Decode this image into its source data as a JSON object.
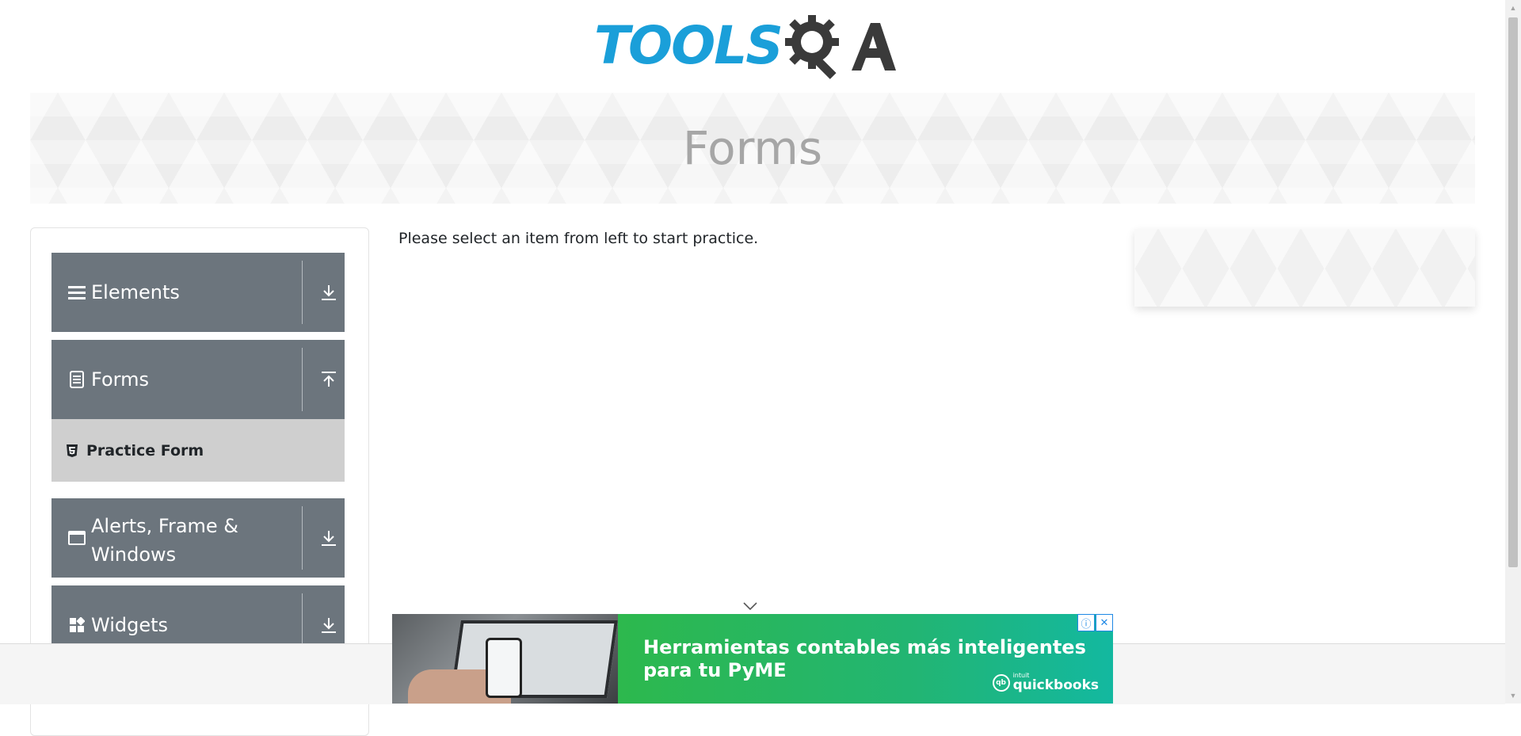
{
  "header": {
    "logo_text_tools": "TOOLS",
    "logo_text_qa": "QA"
  },
  "banner": {
    "title": "Forms"
  },
  "sidebar": {
    "groups": [
      {
        "label": "Elements",
        "icon": "menu-icon",
        "state": "collapsed"
      },
      {
        "label": "Forms",
        "icon": "document-icon",
        "state": "expanded"
      },
      {
        "label": "Alerts, Frame & Windows",
        "icon": "window-icon",
        "state": "collapsed"
      },
      {
        "label": "Widgets",
        "icon": "widgets-icon",
        "state": "collapsed"
      }
    ],
    "forms_items": [
      {
        "label": "Practice Form",
        "icon": "html5-icon"
      }
    ]
  },
  "main": {
    "prompt": "Please select an item from left to start practice."
  },
  "ad": {
    "headline": "Herramientas contables más inteligentes para tu PyME",
    "brand": "quickbooks",
    "brand_prefix": "intuit",
    "info_glyph": "ⓘ",
    "close_glyph": "✕"
  },
  "colors": {
    "logo_blue": "#1a9fd9",
    "logo_dark": "#3a3a3a",
    "sidebar_group_bg": "#6c757d",
    "submenu_bg": "#cfcfcf",
    "ad_green": "#22b573"
  }
}
